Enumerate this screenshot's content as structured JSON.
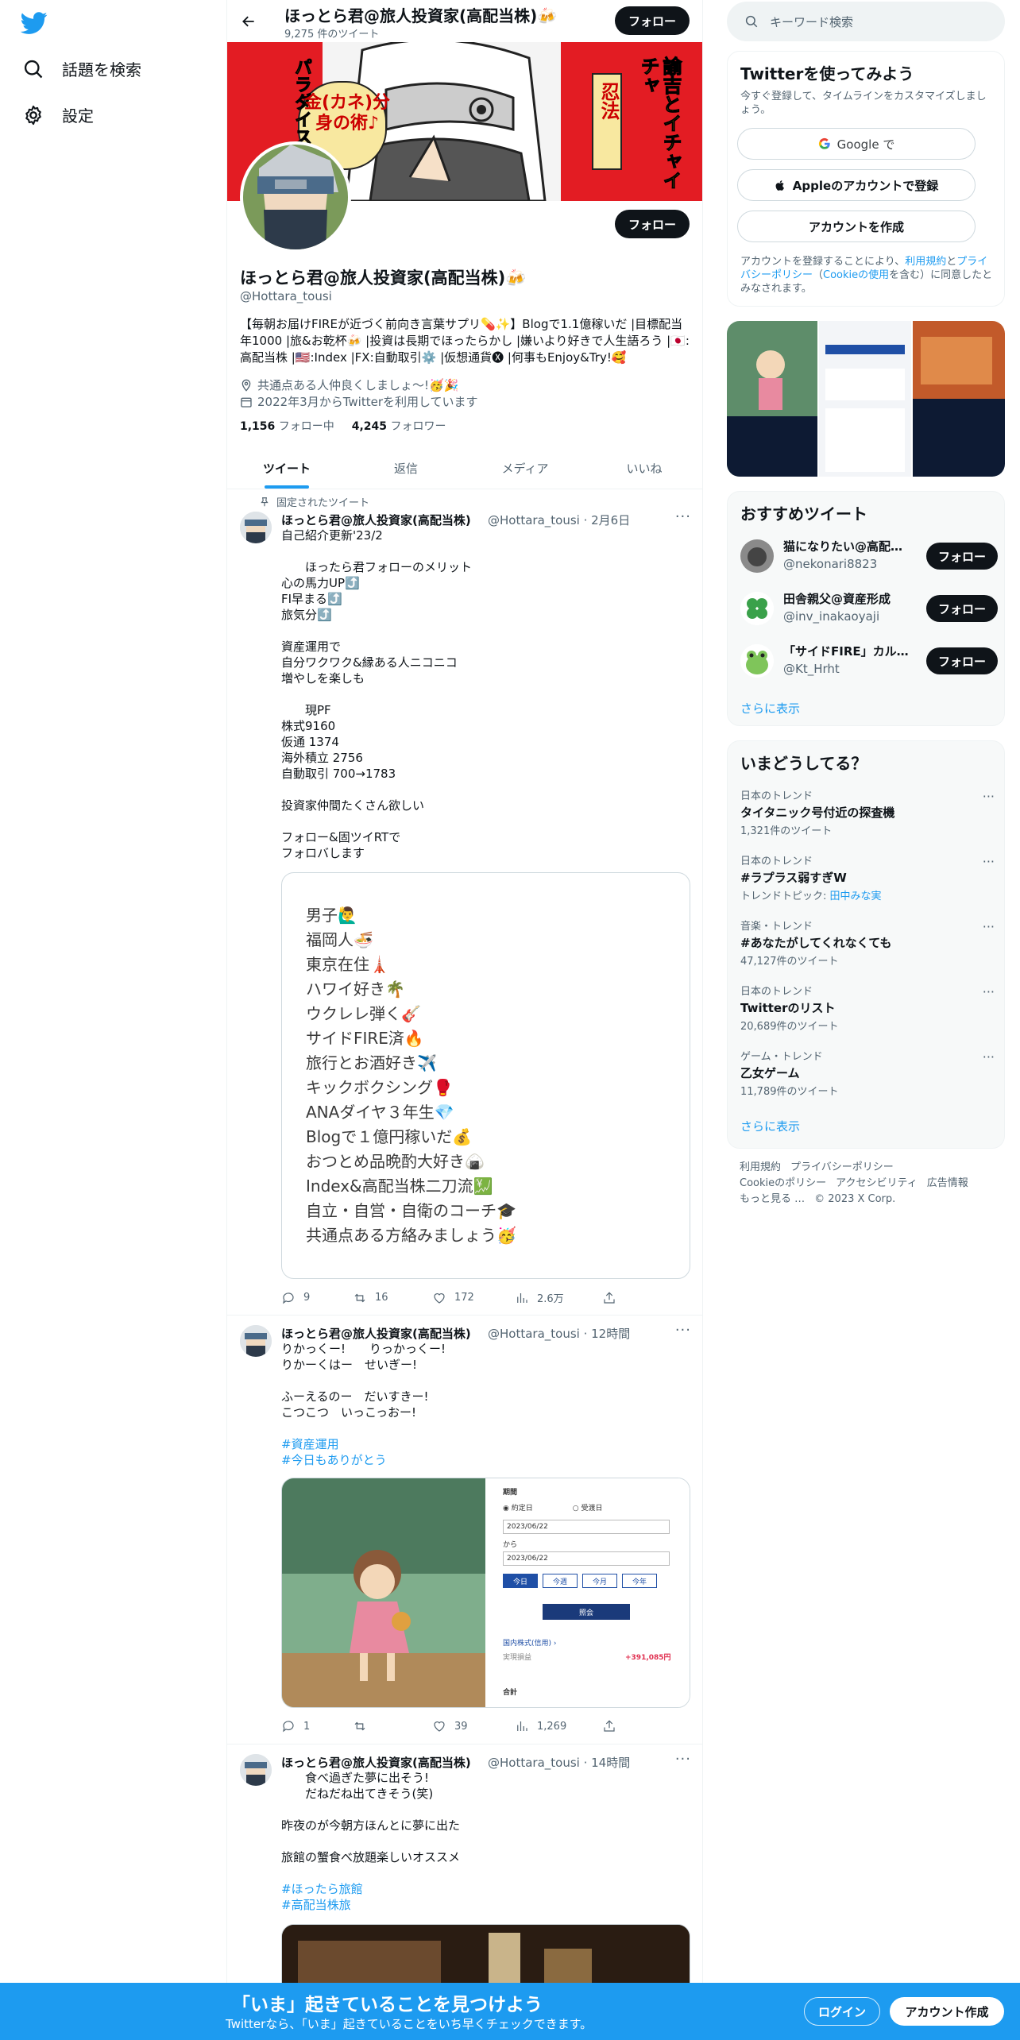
{
  "left_nav": {
    "explore_label": "話題を検索",
    "settings_label": "設定"
  },
  "topbar": {
    "name": "ほっとら君@旅人投資家(高配当株)🍻",
    "tweet_count": "9,275 件のツイート",
    "follow_label": "フォロー"
  },
  "banner": {
    "text_left": "パラダイス",
    "text_middle": "金(カネ)分身の術♪",
    "text_right_1": "忍法",
    "text_right_2": "諭吉とイチャイチャ"
  },
  "profile": {
    "follow_label": "フォロー",
    "name": "ほっとら君@旅人投資家(高配当株)🍻",
    "handle": "@Hottara_tousi",
    "bio": "【毎朝お届けFIREが近づく前向き言葉サプリ💊✨】Blogで1.1億稼いだ |目標配当年1000 |旅&お乾杯🍻 |投資は長期でほったらかし |嫌いより好きで人生語ろう |🇯🇵:高配当株 |🇺🇸:Index |FX:自動取引⚙️ |仮想通貨🅧 |何事もEnjoy&Try!🥰",
    "location": "共通点ある人仲良くしましょ〜!🥳🎉",
    "joined": "2022年3月からTwitterを利用しています",
    "following_count": "1,156",
    "following_label": "フォロー中",
    "followers_count": "4,245",
    "followers_label": "フォロワー"
  },
  "tabs": [
    "ツイート",
    "返信",
    "メディア",
    "いいね"
  ],
  "tweets": [
    {
      "pinned_label": "固定されたツイート",
      "name": "ほっとら君@旅人投資家(高配当株)",
      "handle_time": "@Hottara_tousi · 2月6日",
      "text": "自己紹介更新'23/2\n\n　　ほったら君フォローのメリット\n心の馬力UP⤴️\nFI早まる⤴️\n旅気分⤴️\n\n資産運用で\n自分ワクワク&縁ある人ニコニコ\n増やしを楽しも\n\n　　現PF\n株式9160\n仮通 1374\n海外積立 2756\n自動取引 700→1783\n\n投資家仲間たくさん欲しい\n\nフォロー&固ツイRTで\nフォロバします",
      "card_lines": "男子🙋‍♂️\n福岡人🍜\n東京在住🗼\nハワイ好き🌴\nウクレレ弾く🎸\nサイドFIRE済🔥\n旅行とお酒好き✈️\nキックボクシング🥊\nANAダイヤ３年生💎\nBlogで１億円稼いだ💰\nおつとめ品晩酌大好き🍙\nIndex&高配当株二刀流💹\n自立・自営・自衛のコーチ🎓\n共通点ある方絡みましょう🥳",
      "replies": "9",
      "retweets": "16",
      "likes": "172",
      "views": "2.6万"
    },
    {
      "name": "ほっとら君@旅人投資家(高配当株)",
      "handle_time": "@Hottara_tousi · 12時間",
      "text": "りかっくー!　　りっかっくー!\nりかーくはー　せいぎー!\n\nふーえるのー　だいすきー!\nこつこつ　いっこっおー!",
      "hashtags": [
        "#資産運用",
        "#今日もありがとう"
      ],
      "image": {
        "period_label": "期間",
        "radio_1": "約定日",
        "radio_2": "受渡日",
        "date_1": "2023/06/22",
        "from_label": "から",
        "date_2": "2023/06/22",
        "chips": [
          "今日",
          "今週",
          "今月",
          "今年"
        ],
        "submit": "照会",
        "row1_label": "国内株式(信用) ›",
        "row1_sub": "実現損益",
        "row1_value": "+391,085円",
        "total_label": "合計"
      },
      "replies": "1",
      "retweets": "",
      "likes": "39",
      "views": "1,269"
    },
    {
      "name": "ほっとら君@旅人投資家(高配当株)",
      "handle_time": "@Hottara_tousi · 14時間",
      "text": "　　食べ過ぎた夢に出そう!\n　　だねだね出てきそう(笑)\n\n昨夜のが今朝方ほんとに夢に出た\n\n旅館の蟹食べ放題楽しいオススメ",
      "hashtags": [
        "#ほったら旅館",
        "#高配当株旅"
      ]
    }
  ],
  "right": {
    "search_placeholder": "キーワード検索",
    "signup_panel": {
      "title": "Twitterを使ってみよう",
      "subtitle": "今すぐ登録して、タイムラインをカスタマイズしましょう。",
      "google_label": "Google で",
      "apple_label": "Appleのアカウントで登録",
      "create_label": "アカウントを作成",
      "terms_pre": "アカウントを登録することにより、",
      "terms_link1": "利用規約",
      "terms_mid": "と",
      "terms_link2": "プライバシーポリシー",
      "terms_paren_pre": "（",
      "terms_link3": "Cookieの使用",
      "terms_post": "を含む）に同意したとみなされます。"
    },
    "recommended": {
      "title": "おすすめツイート",
      "users": [
        {
          "name": "猫になりたい@高配当株",
          "handle": "@nekonari8823",
          "follow": "フォロー"
        },
        {
          "name": "田舎親父@資産形成",
          "handle": "@inv_inakaoyaji",
          "follow": "フォロー"
        },
        {
          "name": "「サイドFIRE」カルロス",
          "handle": "@Kt_Hrht",
          "follow": "フォロー"
        }
      ],
      "more": "さらに表示"
    },
    "trends": {
      "title": "いまどうしてる？",
      "items": [
        {
          "context": "日本のトレンド",
          "topic": "タイタニック号付近の探査機",
          "count": "1,321件のツイート"
        },
        {
          "context": "日本のトレンド",
          "topic": "#ラプラス弱すぎW",
          "count_prefix": "トレンドトピック: ",
          "count_link": "田中みな実"
        },
        {
          "context": "音楽・トレンド",
          "topic": "#あなたがしてくれなくても",
          "count": "47,127件のツイート"
        },
        {
          "context": "日本のトレンド",
          "topic": "Twitterのリスト",
          "count": "20,689件のツイート"
        },
        {
          "context": "ゲーム・トレンド",
          "topic": "乙女ゲーム",
          "count": "11,789件のツイート"
        }
      ],
      "more": "さらに表示"
    },
    "footer": {
      "links": [
        "利用規約",
        "プライバシーポリシー",
        "Cookieのポリシー",
        "アクセシビリティ",
        "広告情報",
        "もっと見る …"
      ],
      "copyright": "© 2023 X Corp."
    }
  },
  "bottom_bar": {
    "title": "「いま」起きていることを見つけよう",
    "subtitle": "Twitterなら、「いま」起きていることをいち早くチェックできます。",
    "login": "ログイン",
    "signup": "アカウント作成"
  },
  "colors": {
    "accent": "#1d9bf0",
    "banner_red": "#e31c23",
    "text": "#0f1419",
    "muted": "#536471"
  }
}
